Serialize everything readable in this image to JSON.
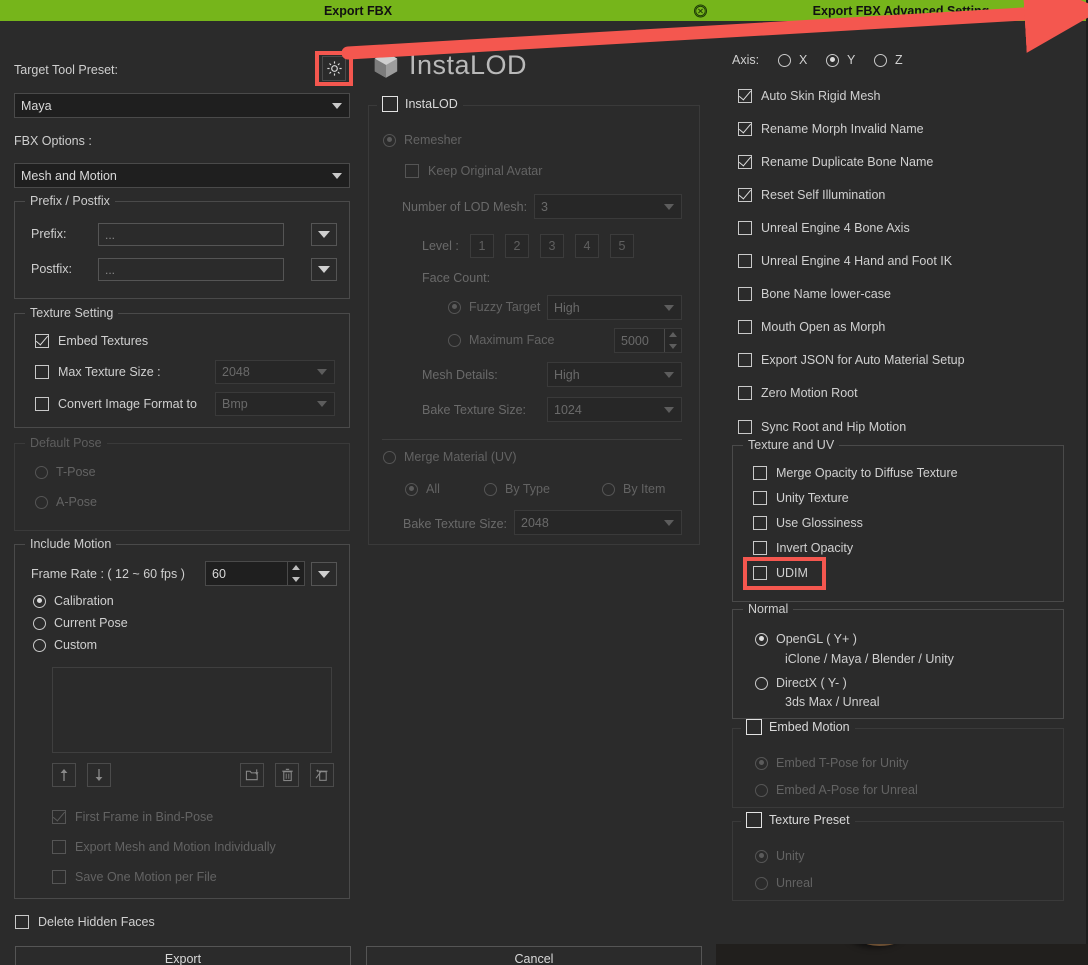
{
  "main_dialog": {
    "title": "Export FBX",
    "close_icon": "close-circle-icon",
    "target_tool_preset_label": "Target Tool Preset:",
    "gear_button_icon": "gear-icon",
    "preset_value": "Maya",
    "fbx_options_label": "FBX Options :",
    "fbx_options_value": "Mesh and Motion",
    "logo_text": "InstaLOD",
    "prefix_postfix": {
      "title": "Prefix / Postfix",
      "prefix_label": "Prefix:",
      "prefix_value": "",
      "prefix_placeholder": "...",
      "postfix_label": "Postfix:",
      "postfix_value": "",
      "postfix_placeholder": "..."
    },
    "texture_setting": {
      "title": "Texture Setting",
      "embed_textures": {
        "label": "Embed Textures",
        "checked": true
      },
      "max_texture_size": {
        "label": "Max Texture Size :",
        "checked": false,
        "value": "2048"
      },
      "convert_image_format": {
        "label": "Convert Image Format to",
        "checked": false,
        "value": "Bmp"
      }
    },
    "default_pose": {
      "title": "Default Pose",
      "t_pose": {
        "label": "T-Pose",
        "selected": false
      },
      "a_pose": {
        "label": "A-Pose",
        "selected": false
      }
    },
    "include_motion": {
      "title": "Include Motion",
      "frame_rate_label": "Frame Rate : ( 12 ~ 60 fps )",
      "frame_rate_value": "60",
      "calibration": {
        "label": "Calibration",
        "selected": true
      },
      "current_pose": {
        "label": "Current Pose",
        "selected": false
      },
      "custom": {
        "label": "Custom",
        "selected": false
      },
      "toolbar_icons": [
        "move-up-icon",
        "move-down-icon",
        "load-motion-icon",
        "delete-icon",
        "clear-all-icon"
      ],
      "first_frame_bind_pose": {
        "label": "First Frame in Bind-Pose",
        "checked": true
      },
      "export_mesh_motion_individually": {
        "label": "Export Mesh and Motion Individually",
        "checked": false
      },
      "save_one_motion_per_file": {
        "label": "Save One Motion per File",
        "checked": false
      }
    },
    "delete_hidden_faces": {
      "label": "Delete Hidden Faces",
      "checked": false
    },
    "export_button": "Export",
    "cancel_button": "Cancel"
  },
  "instalod_panel": {
    "title": "InstaLOD",
    "enabled": false,
    "remesher": {
      "label": "Remesher",
      "selected": true
    },
    "keep_original_avatar": {
      "label": "Keep Original Avatar",
      "checked": false
    },
    "number_of_lod_mesh": {
      "label": "Number of LOD Mesh:",
      "value": "3"
    },
    "level_label": "Level :",
    "levels": [
      "1",
      "2",
      "3",
      "4",
      "5"
    ],
    "face_count_label": "Face Count:",
    "fuzzy_target": {
      "label": "Fuzzy Target",
      "selected": true,
      "value": "High"
    },
    "maximum_face": {
      "label": "Maximum Face",
      "selected": false,
      "value": "5000"
    },
    "mesh_details": {
      "label": "Mesh Details:",
      "value": "High"
    },
    "bake_texture_size_1": {
      "label": "Bake Texture Size:",
      "value": "1024"
    },
    "merge_material_uv": {
      "label": "Merge Material (UV)",
      "selected": false
    },
    "merge_all": {
      "label": "All",
      "selected": true
    },
    "merge_by_type": {
      "label": "By Type",
      "selected": false
    },
    "merge_by_item": {
      "label": "By Item",
      "selected": false
    },
    "bake_texture_size_2": {
      "label": "Bake Texture Size:",
      "value": "2048"
    }
  },
  "advanced_dialog": {
    "title": "Export FBX Advanced Setting",
    "close_icon": "close-circle-icon",
    "axis": {
      "label": "Axis:",
      "options": [
        {
          "label": "X",
          "selected": false
        },
        {
          "label": "Y",
          "selected": true
        },
        {
          "label": "Z",
          "selected": false
        }
      ]
    },
    "checkboxes": [
      {
        "label": "Auto Skin Rigid Mesh",
        "checked": true
      },
      {
        "label": "Rename Morph Invalid Name",
        "checked": true
      },
      {
        "label": "Rename Duplicate Bone Name",
        "checked": true
      },
      {
        "label": "Reset Self Illumination",
        "checked": true
      },
      {
        "label": "Unreal Engine 4 Bone Axis",
        "checked": false
      },
      {
        "label": "Unreal Engine 4 Hand and Foot IK",
        "checked": false
      },
      {
        "label": "Bone Name lower-case",
        "checked": false
      },
      {
        "label": "Mouth Open as Morph",
        "checked": false
      },
      {
        "label": "Export JSON for Auto Material Setup",
        "checked": false
      },
      {
        "label": "Zero Motion Root",
        "checked": false
      },
      {
        "label": "Sync Root and Hip Motion",
        "checked": false
      }
    ],
    "texture_and_uv": {
      "title": "Texture and UV",
      "items": [
        {
          "label": "Merge Opacity to Diffuse Texture",
          "checked": false
        },
        {
          "label": "Unity Texture",
          "checked": false
        },
        {
          "label": "Use Glossiness",
          "checked": false
        },
        {
          "label": "Invert Opacity",
          "checked": false
        },
        {
          "label": "UDIM",
          "checked": false,
          "highlighted": true
        }
      ]
    },
    "normal": {
      "title": "Normal",
      "opengl": {
        "label": "OpenGL ( Y+ )",
        "sub": "iClone / Maya / Blender / Unity",
        "selected": true
      },
      "directx": {
        "label": "DirectX ( Y- )",
        "sub": "3ds Max / Unreal",
        "selected": false
      }
    },
    "embed_motion": {
      "title": "Embed Motion",
      "checked": false,
      "t_pose_unity": {
        "label": "Embed T-Pose for Unity",
        "selected": true
      },
      "a_pose_unreal": {
        "label": "Embed A-Pose for Unreal",
        "selected": false
      }
    },
    "texture_preset": {
      "title": "Texture Preset",
      "checked": false,
      "unity": {
        "label": "Unity",
        "selected": true
      },
      "unreal": {
        "label": "Unreal",
        "selected": false
      }
    }
  },
  "annotations": {
    "arrow_color": "#f4574f",
    "highlight_color": "#f4574f",
    "arrow_from": "gear-button",
    "arrow_to": "advanced-setting-dialog"
  },
  "theme": {
    "title_bar_green": "#76b51b",
    "panel_bg": "#2b2b2b",
    "text": "#d0d0d0"
  }
}
